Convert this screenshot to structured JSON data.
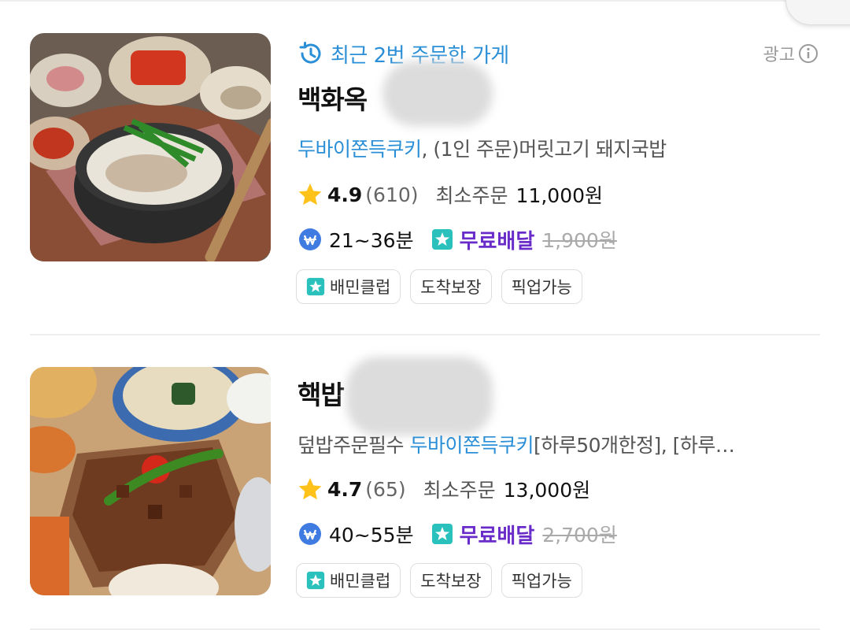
{
  "stores": [
    {
      "recent_label": "최근 2번 주문한 가게",
      "ad_label": "광고",
      "name": "백화옥 ",
      "menu_highlight": "두바이쫀득쿠키",
      "menu_rest": ", (1인 주문)머릿고기 돼지국밥",
      "rating": "4.9",
      "review_count": "(610)",
      "min_order_label": "최소주문",
      "min_order": "11,000원",
      "delivery_time": "21~36분",
      "free_delivery_label": "무료배달",
      "original_fee": "1,900원",
      "tags": [
        "배민클럽",
        "도착보장",
        "픽업가능"
      ]
    },
    {
      "name": "핵밥",
      "menu_prefix": "덮밥주문필수 ",
      "menu_highlight": "두바이쫀득쿠키",
      "menu_rest": "[하루50개한정], [하루…",
      "rating": "4.7",
      "review_count": "(65)",
      "min_order_label": "최소주문",
      "min_order": "13,000원",
      "delivery_time": "40~55분",
      "free_delivery_label": "무료배달",
      "original_fee": "2,700원",
      "tags": [
        "배민클럽",
        "도착보장",
        "픽업가능"
      ]
    }
  ],
  "colors": {
    "highlight_blue": "#2a8fd6",
    "free_delivery_purple": "#6a2cc9",
    "club_teal": "#2ac1bc",
    "star_yellow": "#ffc21a"
  }
}
